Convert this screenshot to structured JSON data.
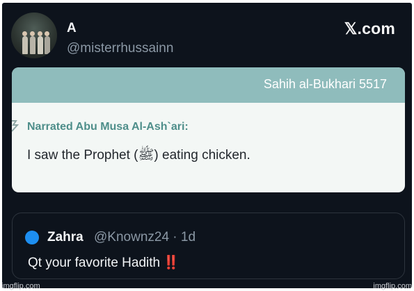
{
  "tweet": {
    "author_name": "A",
    "author_handle": "@misterrhussainn",
    "site_logo": "𝕏.com"
  },
  "card": {
    "reference": "Sahih al-Bukhari 5517",
    "narrator": "Narrated Abu Musa Al-Ash`ari:",
    "text": "I saw the Prophet (ﷺ) eating chicken.",
    "header_color": "#8fbcbc",
    "narrator_color": "#4e8e8a"
  },
  "quote": {
    "name": "Zahra",
    "meta": "@Knownz24 · 1d",
    "text": "Qt your favorite Hadith",
    "emoji": "‼️",
    "avatar_color": "#1d8ef0"
  },
  "watermark": {
    "left": "imgflip.com",
    "right": "imgflip.com"
  },
  "colors": {
    "background": "#0d131c",
    "primary_text": "#f2f4f6",
    "secondary_text": "#8b98a5"
  }
}
